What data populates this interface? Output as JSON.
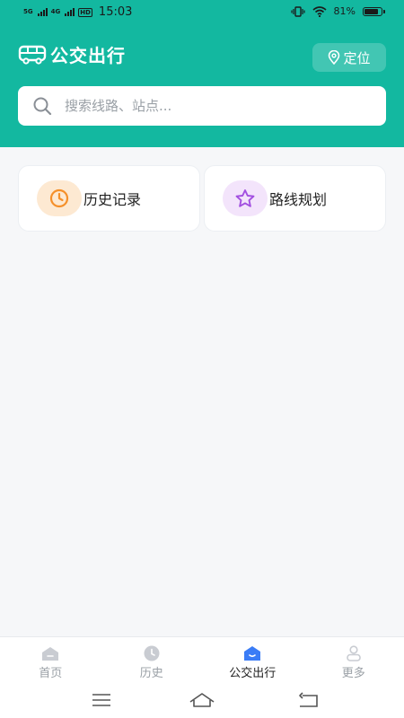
{
  "status_bar": {
    "network1": "5G",
    "network2": "4G",
    "hd": "HD",
    "time": "15:03",
    "battery_text": "81%",
    "battery_level": 0.81
  },
  "header": {
    "title": "公交出行",
    "title_icon": "bus-icon",
    "locate_label": "定位",
    "locate_icon": "location-pin-icon"
  },
  "search": {
    "placeholder": "搜索线路、站点...",
    "icon": "search-icon"
  },
  "quick_actions": [
    {
      "label": "历史记录",
      "icon": "clock-icon",
      "color": "#f5902a",
      "bg": "#fde9d2"
    },
    {
      "label": "路线规划",
      "icon": "star-icon",
      "color": "#a24fe0",
      "bg": "#f3e4fb"
    }
  ],
  "tabs": [
    {
      "label": "首页",
      "icon": "home-icon"
    },
    {
      "label": "历史",
      "icon": "clock-icon"
    },
    {
      "label": "公交出行",
      "icon": "bus-home-icon",
      "active": true
    },
    {
      "label": "更多",
      "icon": "user-icon"
    }
  ],
  "colors": {
    "brand": "#13b8a0",
    "active_tab": "#3a7cf6",
    "inactive_tab": "#c9ccd2",
    "background": "#f6f7f9"
  },
  "system_nav": [
    "menu-icon",
    "home-outline-icon",
    "back-icon"
  ]
}
